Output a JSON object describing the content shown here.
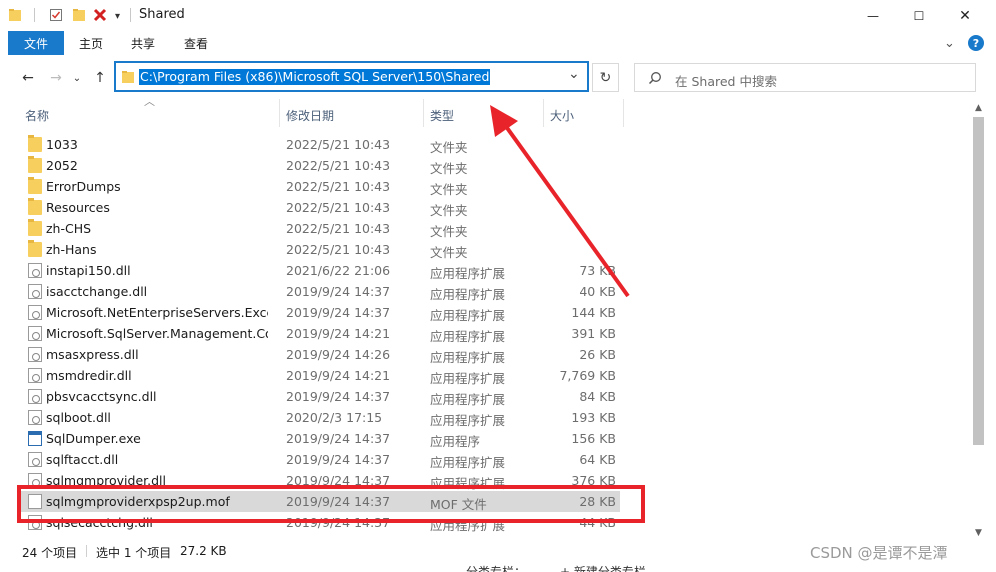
{
  "window": {
    "title": "Shared",
    "controls": {
      "minimize": "—",
      "maximize": "☐",
      "close": "✕"
    },
    "help_icon": "?",
    "ribbon_collapse": "⌄",
    "qa_dropdown": "▾"
  },
  "ribbon": {
    "file_tab": "文件",
    "tabs": [
      "主页",
      "共享",
      "查看"
    ]
  },
  "address": {
    "path": "C:\\Program Files (x86)\\Microsoft SQL Server\\150\\Shared",
    "dropdown_icon": "⌄",
    "refresh_icon": "↻"
  },
  "nav": {
    "back": "←",
    "forward": "→",
    "recent": "⌄",
    "up": "↑"
  },
  "search": {
    "placeholder": "在 Shared 中搜索"
  },
  "columns": {
    "name": "名称",
    "date": "修改日期",
    "type": "类型",
    "size": "大小",
    "sort_indicator": "︿"
  },
  "files": [
    {
      "name": "1033",
      "date": "2022/5/21 10:43",
      "type": "文件夹",
      "size": "",
      "icon": "folder"
    },
    {
      "name": "2052",
      "date": "2022/5/21 10:43",
      "type": "文件夹",
      "size": "",
      "icon": "folder"
    },
    {
      "name": "ErrorDumps",
      "date": "2022/5/21 10:43",
      "type": "文件夹",
      "size": "",
      "icon": "folder"
    },
    {
      "name": "Resources",
      "date": "2022/5/21 10:43",
      "type": "文件夹",
      "size": "",
      "icon": "folder"
    },
    {
      "name": "zh-CHS",
      "date": "2022/5/21 10:43",
      "type": "文件夹",
      "size": "",
      "icon": "folder"
    },
    {
      "name": "zh-Hans",
      "date": "2022/5/21 10:43",
      "type": "文件夹",
      "size": "",
      "icon": "folder"
    },
    {
      "name": "instapi150.dll",
      "date": "2021/6/22 21:06",
      "type": "应用程序扩展",
      "size": "73 KB",
      "icon": "dll"
    },
    {
      "name": "isacctchange.dll",
      "date": "2019/9/24 14:37",
      "type": "应用程序扩展",
      "size": "40 KB",
      "icon": "dll"
    },
    {
      "name": "Microsoft.NetEnterpriseServers.Exce...",
      "date": "2019/9/24 14:37",
      "type": "应用程序扩展",
      "size": "144 KB",
      "icon": "dll"
    },
    {
      "name": "Microsoft.SqlServer.Management.Co...",
      "date": "2019/9/24 14:21",
      "type": "应用程序扩展",
      "size": "391 KB",
      "icon": "dll"
    },
    {
      "name": "msasxpress.dll",
      "date": "2019/9/24 14:26",
      "type": "应用程序扩展",
      "size": "26 KB",
      "icon": "dll"
    },
    {
      "name": "msmdredir.dll",
      "date": "2019/9/24 14:21",
      "type": "应用程序扩展",
      "size": "7,769 KB",
      "icon": "dll"
    },
    {
      "name": "pbsvcacctsync.dll",
      "date": "2019/9/24 14:37",
      "type": "应用程序扩展",
      "size": "84 KB",
      "icon": "dll"
    },
    {
      "name": "sqlboot.dll",
      "date": "2020/2/3 17:15",
      "type": "应用程序扩展",
      "size": "193 KB",
      "icon": "dll"
    },
    {
      "name": "SqlDumper.exe",
      "date": "2019/9/24 14:37",
      "type": "应用程序",
      "size": "156 KB",
      "icon": "exe"
    },
    {
      "name": "sqlftacct.dll",
      "date": "2019/9/24 14:37",
      "type": "应用程序扩展",
      "size": "64 KB",
      "icon": "dll"
    },
    {
      "name": "sqlmgmprovider.dll",
      "date": "2019/9/24 14:37",
      "type": "应用程序扩展",
      "size": "376 KB",
      "icon": "dll"
    },
    {
      "name": "sqlmgmproviderxpsp2up.mof",
      "date": "2019/9/24 14:37",
      "type": "MOF 文件",
      "size": "28 KB",
      "icon": "mof",
      "selected": true
    },
    {
      "name": "sqlsecacctchg.dll",
      "date": "2019/9/24 14:37",
      "type": "应用程序扩展",
      "size": "44 KB",
      "icon": "dll"
    }
  ],
  "status": {
    "item_count": "24 个项目",
    "selection": "选中 1 个项目",
    "selection_size": "27.2 KB"
  },
  "bottom_strip": {
    "left": "分类专栏：",
    "right": "+ 新建分类专栏"
  },
  "watermark": "CSDN @是谭不是潭",
  "annotation_color": "#e8242a",
  "accent_color": "#1979ca"
}
